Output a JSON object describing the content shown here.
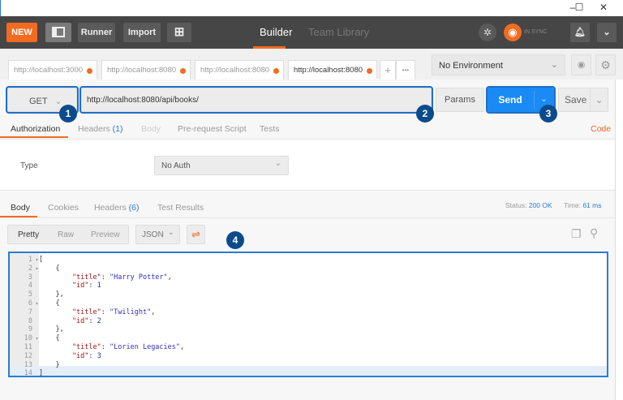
{
  "window": {
    "minimize": "–",
    "maximize": "☐",
    "close": "✕"
  },
  "header": {
    "new": "NEW",
    "runner": "Runner",
    "import": "Import",
    "builder": "Builder",
    "team_library": "Team Library",
    "sync": "IN SYNC"
  },
  "request_tabs": [
    "http://localhost:3000",
    "http://localhost:8080",
    "http://localhost:8080",
    "http://localhost:8080"
  ],
  "tab_actions": {
    "add": "+",
    "more": "•••"
  },
  "environment": {
    "selected": "No Environment"
  },
  "request": {
    "method": "GET",
    "url": "http://localhost:8080/api/books/",
    "params": "Params",
    "send": "Send",
    "save": "Save"
  },
  "req_tabs": {
    "authorization": "Authorization",
    "headers": "Headers",
    "headers_count": "(1)",
    "body": "Body",
    "prerequest": "Pre-request Script",
    "tests": "Tests",
    "code": "Code"
  },
  "auth": {
    "type_label": "Type",
    "type_value": "No Auth"
  },
  "response": {
    "tabs": {
      "body": "Body",
      "cookies": "Cookies",
      "headers": "Headers",
      "headers_count": "(6)",
      "test_results": "Test Results"
    },
    "status_label": "Status:",
    "status": "200 OK",
    "time_label": "Time:",
    "time": "61 ms",
    "views": [
      "Pretty",
      "Raw",
      "Preview"
    ],
    "format": "JSON"
  },
  "badges": [
    "1",
    "2",
    "3",
    "4"
  ],
  "code_lines": [
    {
      "n": "1",
      "f": true,
      "seg": [
        [
          "[",
          "p"
        ]
      ]
    },
    {
      "n": "2",
      "f": true,
      "seg": [
        [
          "    {",
          "p"
        ]
      ]
    },
    {
      "n": "3",
      "f": false,
      "seg": [
        [
          "        \"title\"",
          "k"
        ],
        [
          ": ",
          "p"
        ],
        [
          "\"Harry Potter\"",
          "s"
        ],
        [
          ",",
          "p"
        ]
      ]
    },
    {
      "n": "4",
      "f": false,
      "seg": [
        [
          "        \"id\"",
          "k"
        ],
        [
          ": ",
          "p"
        ],
        [
          "1",
          "n"
        ]
      ]
    },
    {
      "n": "5",
      "f": false,
      "seg": [
        [
          "    },",
          "p"
        ]
      ]
    },
    {
      "n": "6",
      "f": true,
      "seg": [
        [
          "    {",
          "p"
        ]
      ]
    },
    {
      "n": "7",
      "f": false,
      "seg": [
        [
          "        \"title\"",
          "k"
        ],
        [
          ": ",
          "p"
        ],
        [
          "\"Twilight\"",
          "s"
        ],
        [
          ",",
          "p"
        ]
      ]
    },
    {
      "n": "8",
      "f": false,
      "seg": [
        [
          "        \"id\"",
          "k"
        ],
        [
          ": ",
          "p"
        ],
        [
          "2",
          "n"
        ]
      ]
    },
    {
      "n": "9",
      "f": false,
      "seg": [
        [
          "    },",
          "p"
        ]
      ]
    },
    {
      "n": "10",
      "f": true,
      "seg": [
        [
          "    {",
          "p"
        ]
      ]
    },
    {
      "n": "11",
      "f": false,
      "seg": [
        [
          "        \"title\"",
          "k"
        ],
        [
          ": ",
          "p"
        ],
        [
          "\"Lorien Legacies\"",
          "s"
        ],
        [
          ",",
          "p"
        ]
      ]
    },
    {
      "n": "12",
      "f": false,
      "seg": [
        [
          "        \"id\"",
          "k"
        ],
        [
          ": ",
          "p"
        ],
        [
          "3",
          "n"
        ]
      ]
    },
    {
      "n": "13",
      "f": false,
      "seg": [
        [
          "    }",
          "p"
        ]
      ]
    },
    {
      "n": "14",
      "f": false,
      "seg": [
        [
          "]",
          "p"
        ]
      ]
    }
  ]
}
